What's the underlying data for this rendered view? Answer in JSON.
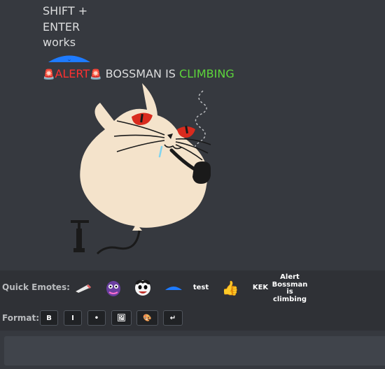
{
  "message": {
    "text": "SHIFT + ENTER works",
    "alert": {
      "word": "ALERT",
      "middle": "BOSSMAN IS",
      "highlight": "CLIMBING"
    }
  },
  "quick_emotes": {
    "label": "Quick Emotes:",
    "items": [
      {
        "icon": "pencil-emote-icon"
      },
      {
        "icon": "purple-creature-emote-icon"
      },
      {
        "icon": "cartoon-face-emote-icon"
      },
      {
        "icon": "blue-cap-emote-icon"
      },
      {
        "text": "test"
      },
      {
        "icon": "thumbs-up-emote-icon"
      },
      {
        "text": "KEK"
      },
      {
        "text": "Alert Bossman is climbing"
      }
    ]
  },
  "format": {
    "label": "Format:",
    "bold": "B",
    "italic": "I",
    "bullet": "•",
    "image": "🖼",
    "color": "🎨",
    "newline": "↵"
  },
  "colors": {
    "background": "#36393f",
    "bar": "#2f3136",
    "alert_red": "#ff3030",
    "climbing_green": "#5dd63b",
    "emote_blue": "#1e7bff"
  }
}
